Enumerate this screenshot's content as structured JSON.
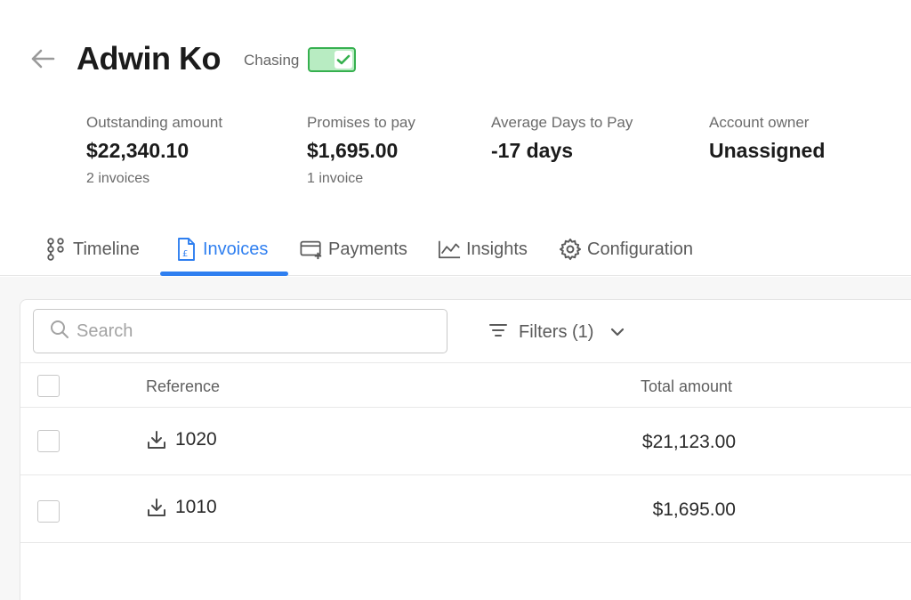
{
  "header": {
    "title": "Adwin Ko",
    "chasing_label": "Chasing",
    "chasing_enabled": true,
    "toggle_color": "#36b04f"
  },
  "stats": [
    {
      "label": "Outstanding amount",
      "value": "$22,340.10",
      "sub": "2 invoices"
    },
    {
      "label": "Promises to pay",
      "value": "$1,695.00",
      "sub": "1 invoice"
    },
    {
      "label": "Average Days to Pay",
      "value": "-17 days",
      "sub": ""
    },
    {
      "label": "Account owner",
      "value": "Unassigned",
      "sub": ""
    }
  ],
  "tabs": [
    {
      "label": "Timeline",
      "icon": "timeline-icon",
      "active": false
    },
    {
      "label": "Invoices",
      "icon": "invoice-icon",
      "active": true
    },
    {
      "label": "Payments",
      "icon": "payments-icon",
      "active": false
    },
    {
      "label": "Insights",
      "icon": "insights-icon",
      "active": false
    },
    {
      "label": "Configuration",
      "icon": "gear-icon",
      "active": false
    }
  ],
  "accent_color": "#2f7ff0",
  "search": {
    "placeholder": "Search",
    "value": ""
  },
  "filters": {
    "label": "Filters (1)"
  },
  "table": {
    "columns": [
      "Reference",
      "Total amount"
    ],
    "rows": [
      {
        "reference": "1020",
        "total": "$21,123.00"
      },
      {
        "reference": "1010",
        "total": "$1,695.00"
      }
    ]
  }
}
